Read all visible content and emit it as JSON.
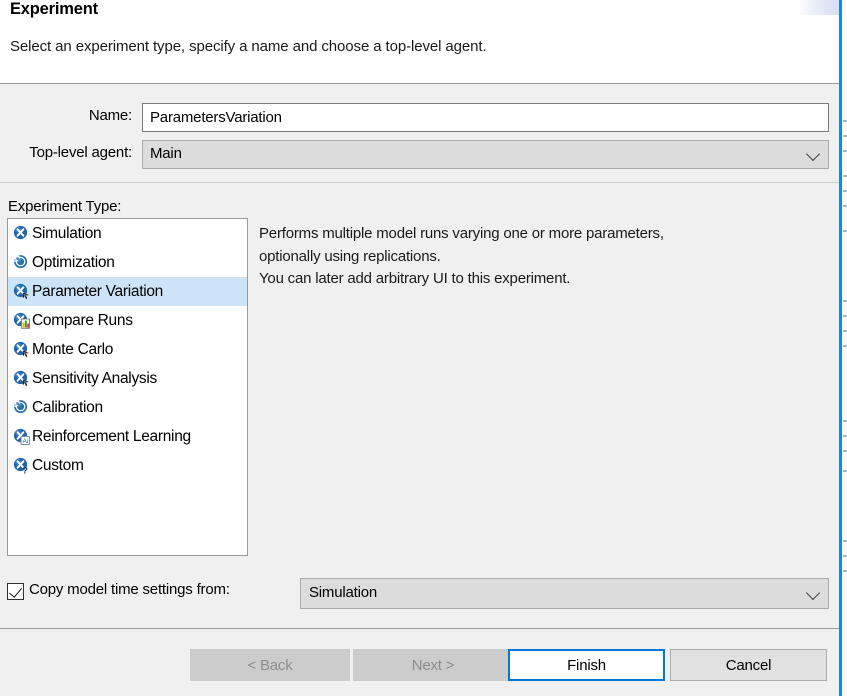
{
  "header": {
    "title": "Experiment",
    "subtitle": "Select an experiment type, specify a name and choose a top-level agent."
  },
  "form": {
    "name_label": "Name:",
    "name_value": "ParametersVariation",
    "name_placeholder": "",
    "agent_label": "Top-level agent:",
    "agent_value": "Main"
  },
  "experiment_type": {
    "label": "Experiment Type:",
    "selected_index": 2,
    "items": [
      {
        "label": "Simulation",
        "icon": "simulation-x-icon"
      },
      {
        "label": "Optimization",
        "icon": "optimization-spiral-icon"
      },
      {
        "label": "Parameter Variation",
        "icon": "parameter-variation-icon"
      },
      {
        "label": "Compare Runs",
        "icon": "compare-runs-chart-icon"
      },
      {
        "label": "Monte Carlo",
        "icon": "monte-carlo-icon"
      },
      {
        "label": "Sensitivity Analysis",
        "icon": "sensitivity-analysis-icon"
      },
      {
        "label": "Calibration",
        "icon": "calibration-spiral-icon"
      },
      {
        "label": "Reinforcement Learning",
        "icon": "reinforcement-learning-ai-icon"
      },
      {
        "label": "Custom",
        "icon": "custom-question-icon"
      }
    ]
  },
  "description": {
    "line1": "Performs multiple model runs varying one or more parameters,",
    "line2": "optionally using replications.",
    "line3": "You can later add arbitrary UI to this experiment."
  },
  "copy_time_settings": {
    "checked": true,
    "label": "Copy model time settings from:",
    "value": "Simulation"
  },
  "buttons": {
    "back": "< Back",
    "next": "Next >",
    "finish": "Finish",
    "cancel": "Cancel"
  },
  "colors": {
    "accent": "#0078d7",
    "selection": "#cce4f7",
    "icon_blue": "#1f64ad",
    "window_border": "#1a87d8",
    "dialog_bg": "#f0f0f0"
  }
}
